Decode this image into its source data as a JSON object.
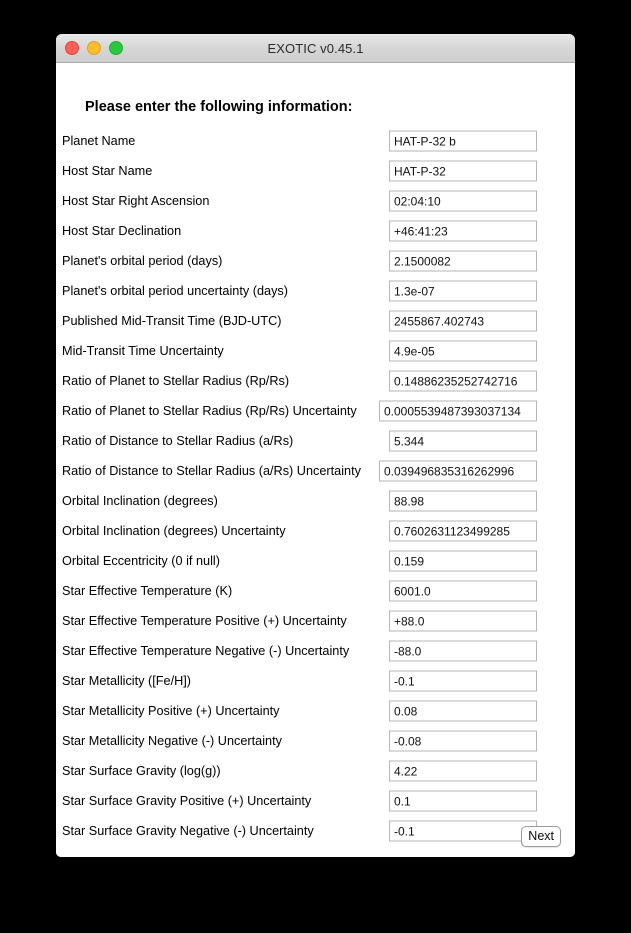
{
  "window": {
    "title": "EXOTIC v0.45.1",
    "traffic_lights": [
      "close-button",
      "minimize-button",
      "maximize-button"
    ]
  },
  "form": {
    "heading": "Please enter the following information:",
    "fields": [
      {
        "label": "Planet Name",
        "value": "HAT-P-32 b",
        "wide": false
      },
      {
        "label": "Host Star Name",
        "value": "HAT-P-32",
        "wide": false
      },
      {
        "label": "Host Star Right Ascension",
        "value": "02:04:10",
        "wide": false
      },
      {
        "label": "Host Star Declination",
        "value": "+46:41:23",
        "wide": false
      },
      {
        "label": "Planet's orbital period (days)",
        "value": "2.1500082",
        "wide": false
      },
      {
        "label": "Planet's orbital period uncertainty (days)",
        "value": "1.3e-07",
        "wide": false
      },
      {
        "label": "Published Mid-Transit Time (BJD-UTC)",
        "value": "2455867.402743",
        "wide": false
      },
      {
        "label": "Mid-Transit Time Uncertainty",
        "value": "4.9e-05",
        "wide": false
      },
      {
        "label": "Ratio of Planet to Stellar Radius (Rp/Rs)",
        "value": "0.14886235252742716",
        "wide": false
      },
      {
        "label": "Ratio of Planet to Stellar Radius (Rp/Rs) Uncertainty",
        "value": "0.0005539487393037134",
        "wide": true
      },
      {
        "label": "Ratio of Distance to Stellar Radius (a/Rs)",
        "value": "5.344",
        "wide": false
      },
      {
        "label": "Ratio of Distance to Stellar Radius (a/Rs) Uncertainty",
        "value": "0.039496835316262996",
        "wide": true
      },
      {
        "label": "Orbital Inclination (degrees)",
        "value": "88.98",
        "wide": false
      },
      {
        "label": "Orbital Inclination (degrees) Uncertainty",
        "value": "0.7602631123499285",
        "wide": false
      },
      {
        "label": "Orbital Eccentricity (0 if null)",
        "value": "0.159",
        "wide": false
      },
      {
        "label": "Star Effective Temperature (K)",
        "value": "6001.0",
        "wide": false
      },
      {
        "label": "Star Effective Temperature Positive (+) Uncertainty",
        "value": "+88.0",
        "wide": false
      },
      {
        "label": "Star Effective Temperature Negative (-) Uncertainty",
        "value": "-88.0",
        "wide": false
      },
      {
        "label": "Star Metallicity ([Fe/H])",
        "value": "-0.1",
        "wide": false
      },
      {
        "label": "Star Metallicity Positive (+) Uncertainty",
        "value": "0.08",
        "wide": false
      },
      {
        "label": "Star Metallicity Negative (-) Uncertainty",
        "value": "-0.08",
        "wide": false
      },
      {
        "label": "Star Surface Gravity (log(g))",
        "value": "4.22",
        "wide": false
      },
      {
        "label": "Star Surface Gravity Positive (+) Uncertainty",
        "value": "0.1",
        "wide": false
      },
      {
        "label": "Star Surface Gravity Negative (-) Uncertainty",
        "value": "-0.1",
        "wide": false
      }
    ],
    "next_label": "Next"
  },
  "colors": {
    "page_background": "#000000",
    "window_background": "#ffffff",
    "titlebar_top": "#e8e8e8",
    "titlebar_bottom": "#cfcfcf",
    "field_border": "#b6b6b6",
    "close": "#ff5f57",
    "minimize": "#febc2e",
    "maximize": "#28c840"
  }
}
